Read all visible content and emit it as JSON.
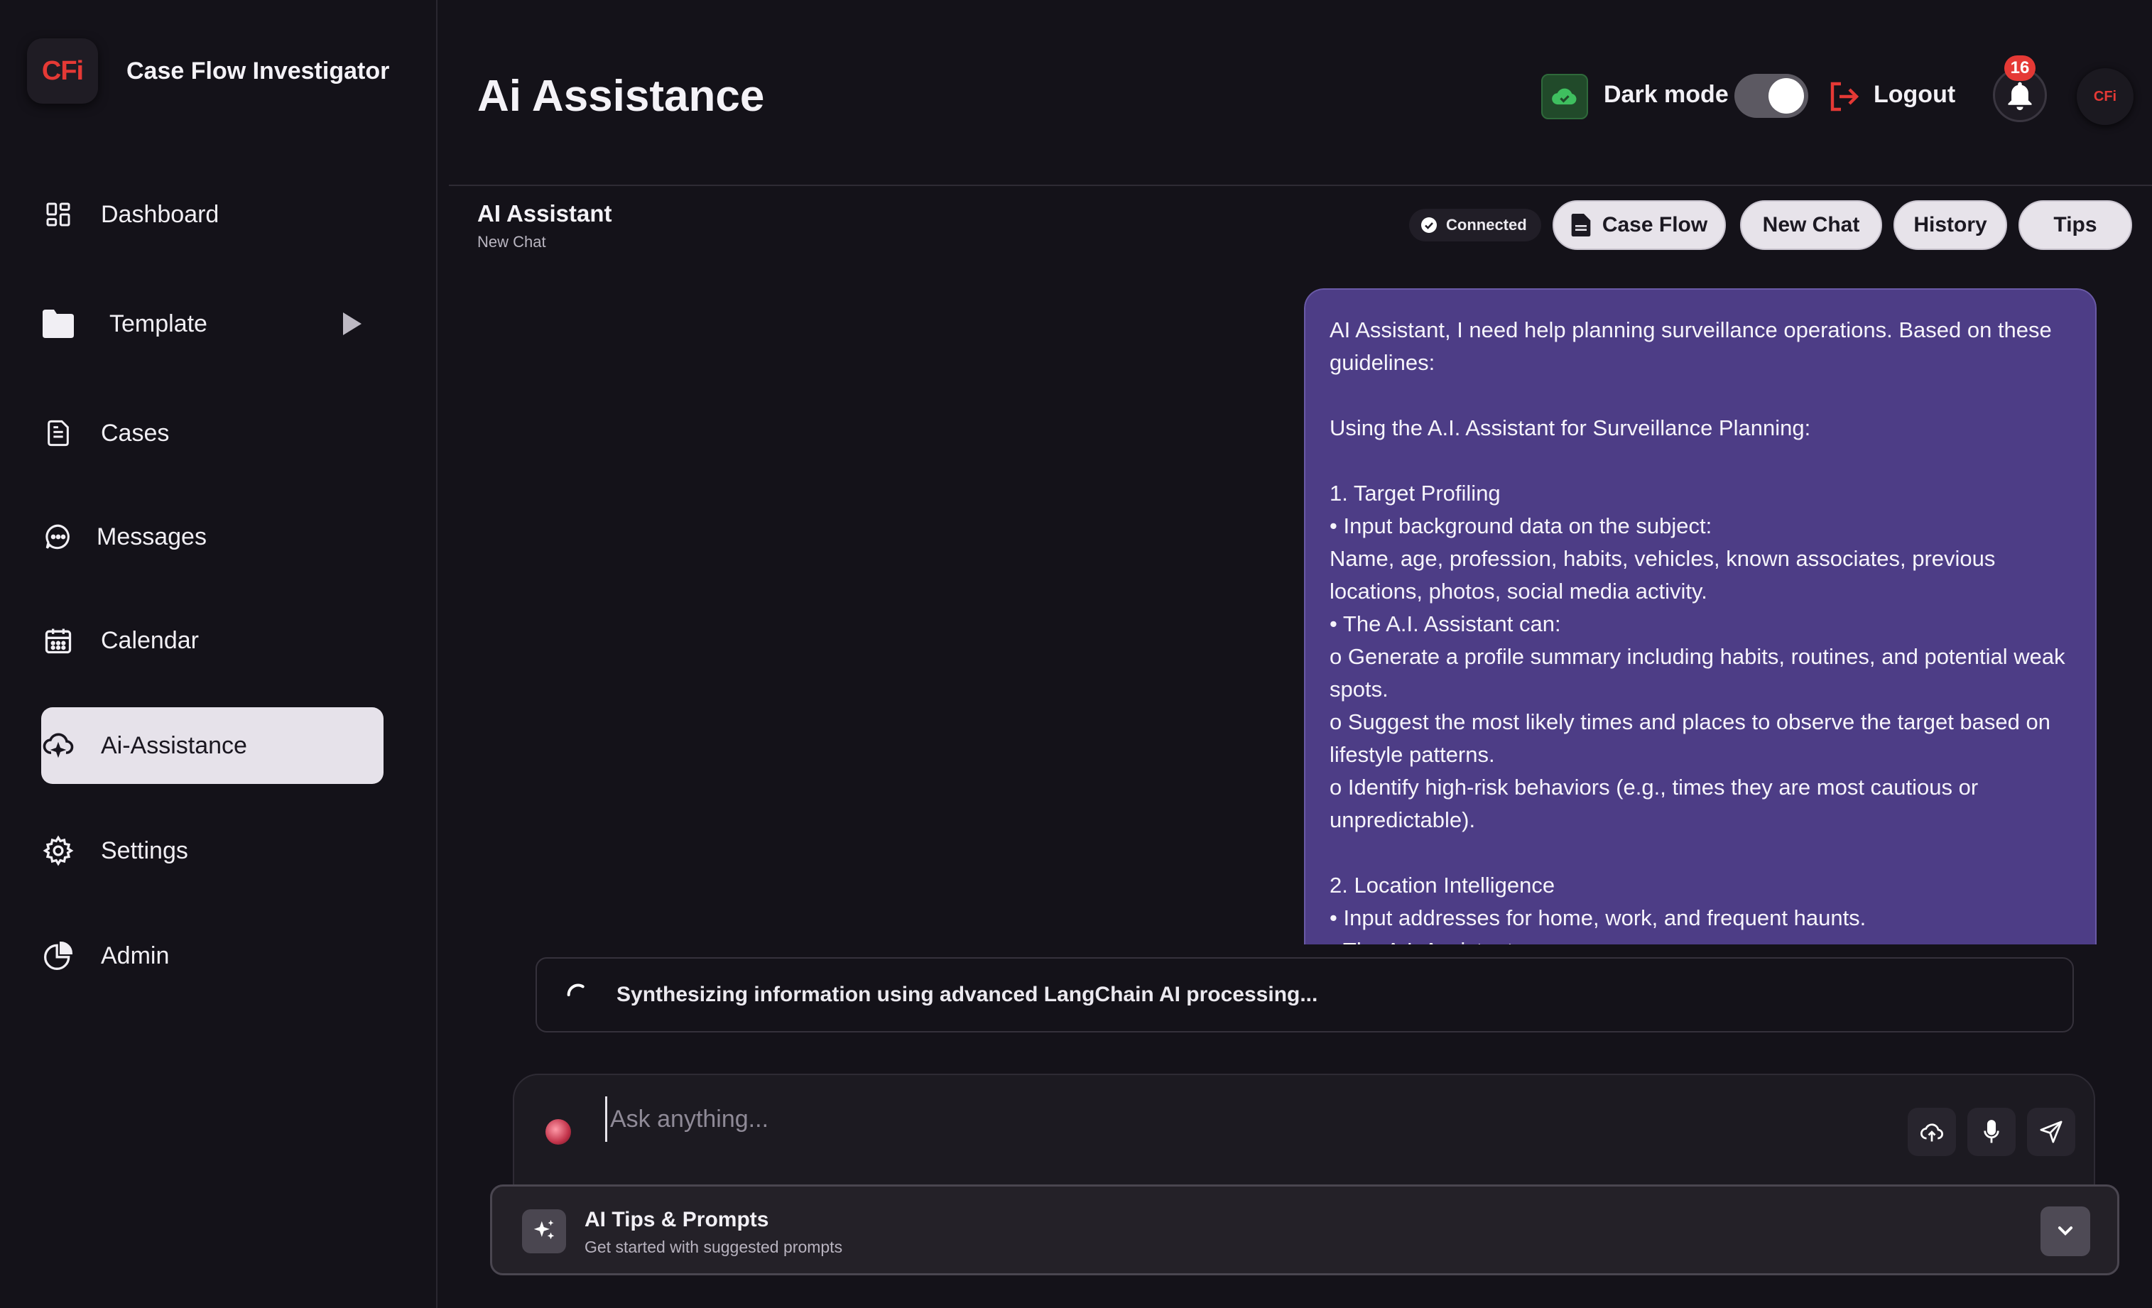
{
  "app": {
    "name": "Case Flow Investigator",
    "logo_text": "CFi"
  },
  "sidebar": {
    "items": [
      {
        "label": "Dashboard",
        "icon": "grid-icon"
      },
      {
        "label": "Template",
        "icon": "folder-icon"
      },
      {
        "label": "Cases",
        "icon": "document-icon"
      },
      {
        "label": "Messages",
        "icon": "chat-bubble-icon"
      },
      {
        "label": "Calendar",
        "icon": "calendar-icon"
      },
      {
        "label": "Ai-Assistance",
        "icon": "cloud-ai-icon",
        "active": true
      },
      {
        "label": "Settings",
        "icon": "gear-icon"
      },
      {
        "label": "Admin",
        "icon": "pie-chart-icon"
      }
    ]
  },
  "header": {
    "page_title": "Ai Assistance",
    "dark_mode_label": "Dark mode",
    "dark_mode_on": true,
    "logout_label": "Logout",
    "notification_count": "16",
    "avatar_text": "CFi"
  },
  "chat": {
    "title": "AI Assistant",
    "subtitle": "New Chat",
    "status": "Connected",
    "buttons": {
      "case_flow": "Case Flow",
      "new_chat": "New Chat",
      "history": "History",
      "tips": "Tips"
    },
    "message": "AI Assistant, I need help planning surveillance operations. Based on these guidelines:\n\nUsing the A.I. Assistant for Surveillance Planning:\n\n1. Target Profiling\n• Input background data on the subject:\nName, age, profession, habits, vehicles, known associates, previous locations, photos, social media activity.\n• The A.I. Assistant can:\no Generate a profile summary including habits, routines, and potential weak spots.\no Suggest the most likely times and places to observe the target based on lifestyle patterns.\no Identify high-risk behaviors (e.g., times they are most cautious or unpredictable).\n\n2. Location Intelligence\n• Input addresses for home, work, and frequent haunts.\n• The A.I. Assistant can:",
    "processing_text": "Synthesizing information using advanced LangChain AI processing...",
    "input_placeholder": "Ask anything..."
  },
  "tips_panel": {
    "title": "AI Tips & Prompts",
    "subtitle": "Get started with suggested prompts"
  },
  "colors": {
    "background": "#141219",
    "bubble": "#4d3d86",
    "accent_red": "#e53935",
    "success_green": "#3fbf5f",
    "active_nav": "#e6e2ea"
  }
}
